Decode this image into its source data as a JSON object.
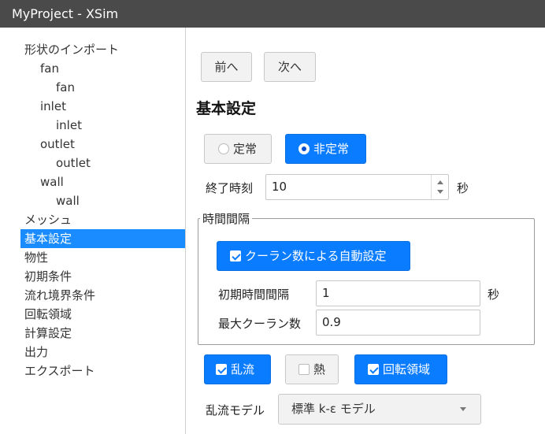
{
  "window": {
    "title": "MyProject - XSim"
  },
  "sidebar": {
    "items": [
      {
        "label": "形状のインポート",
        "level": 0
      },
      {
        "label": "fan",
        "level": 1
      },
      {
        "label": "fan",
        "level": 2
      },
      {
        "label": "inlet",
        "level": 1
      },
      {
        "label": "inlet",
        "level": 2
      },
      {
        "label": "outlet",
        "level": 1
      },
      {
        "label": "outlet",
        "level": 2
      },
      {
        "label": "wall",
        "level": 1
      },
      {
        "label": "wall",
        "level": 2
      },
      {
        "label": "メッシュ",
        "level": 0
      },
      {
        "label": "基本設定",
        "level": 0,
        "selected": true
      },
      {
        "label": "物性",
        "level": 0
      },
      {
        "label": "初期条件",
        "level": 0
      },
      {
        "label": "流れ境界条件",
        "level": 0
      },
      {
        "label": "回転領域",
        "level": 0
      },
      {
        "label": "計算設定",
        "level": 0
      },
      {
        "label": "出力",
        "level": 0
      },
      {
        "label": "エクスポート",
        "level": 0
      }
    ]
  },
  "nav": {
    "prev": "前へ",
    "next": "次へ"
  },
  "page": {
    "title": "基本設定"
  },
  "time_mode": {
    "steady": {
      "label": "定常",
      "selected": false
    },
    "unsteady": {
      "label": "非定常",
      "selected": true
    }
  },
  "end_time": {
    "label": "終了時刻",
    "value": "10",
    "unit": "秒"
  },
  "time_step": {
    "legend": "時間間隔",
    "auto_courant": {
      "label": "クーラン数による自動設定",
      "checked": true
    },
    "initial_step": {
      "label": "初期時間間隔",
      "value": "1",
      "unit": "秒"
    },
    "max_courant": {
      "label": "最大クーラン数",
      "value": "0.9"
    }
  },
  "options": {
    "turbulence": {
      "label": "乱流",
      "checked": true
    },
    "heat": {
      "label": "熱",
      "checked": false
    },
    "rotation": {
      "label": "回転領域",
      "checked": true
    }
  },
  "turbulence_model": {
    "label": "乱流モデル",
    "selected": "標準 k-ε モデル"
  },
  "colors": {
    "accent": "#0a7cff",
    "selected_item": "#1a8cff",
    "titlebar": "#4a4a4a"
  }
}
